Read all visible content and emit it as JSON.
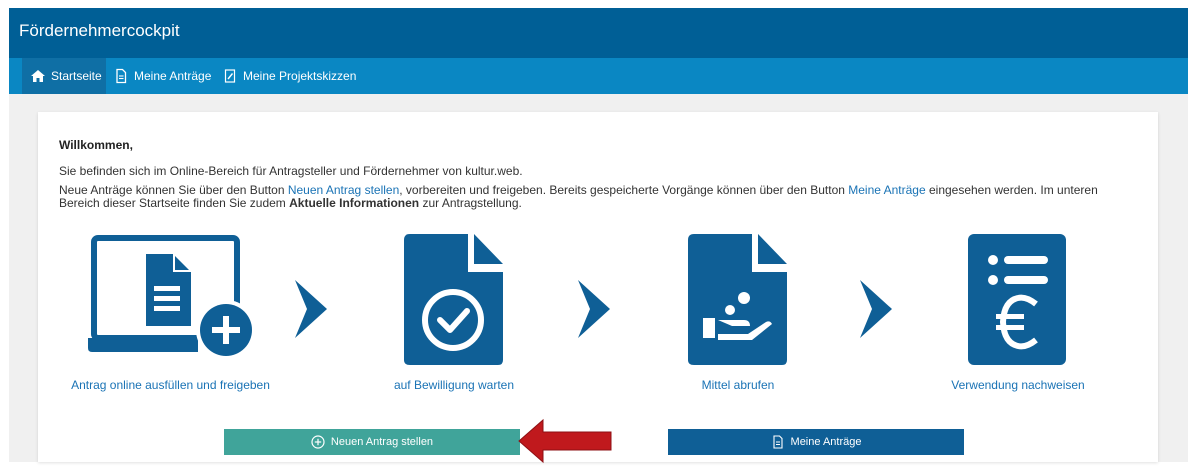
{
  "app": {
    "title": "Fördernehmercockpit"
  },
  "nav": {
    "items": [
      {
        "label": "Startseite",
        "icon": "home-icon",
        "active": true
      },
      {
        "label": "Meine Anträge",
        "icon": "document-icon",
        "active": false
      },
      {
        "label": "Meine Projektskizzen",
        "icon": "edit-document-icon",
        "active": false
      }
    ]
  },
  "welcome": {
    "heading": "Willkommen,",
    "intro": "Sie befinden sich im Online-Bereich für Antragsteller und Fördernehmer von kultur.web.",
    "p_part1": "Neue Anträge können Sie über den Button ",
    "link1": "Neuen Antrag stellen",
    "p_part2": ", vorbereiten und freigeben. Bereits gespeicherte Vorgänge können über den Button ",
    "link2": "Meine Anträge",
    "p_part3": " eingesehen werden. Im unteren Bereich dieser Startseite finden Sie zudem ",
    "bold": "Aktuelle Informationen",
    "p_part4": " zur Antragstellung."
  },
  "steps": [
    {
      "label": "Antrag online ausfüllen und freigeben",
      "icon": "laptop-add-document-icon"
    },
    {
      "label": "auf Bewilligung warten",
      "icon": "document-check-icon"
    },
    {
      "label": "Mittel abrufen",
      "icon": "document-hand-money-icon"
    },
    {
      "label": "Verwendung nachweisen",
      "icon": "list-euro-icon"
    }
  ],
  "buttons": {
    "new_application": "Neuen Antrag stellen",
    "my_applications": "Meine Anträge"
  },
  "colors": {
    "header": "#005f96",
    "nav": "#0a87c3",
    "icon_blue": "#0f5f96",
    "link": "#1a73b5",
    "button_teal": "#40a49a",
    "annotation_arrow": "#c0191d"
  }
}
